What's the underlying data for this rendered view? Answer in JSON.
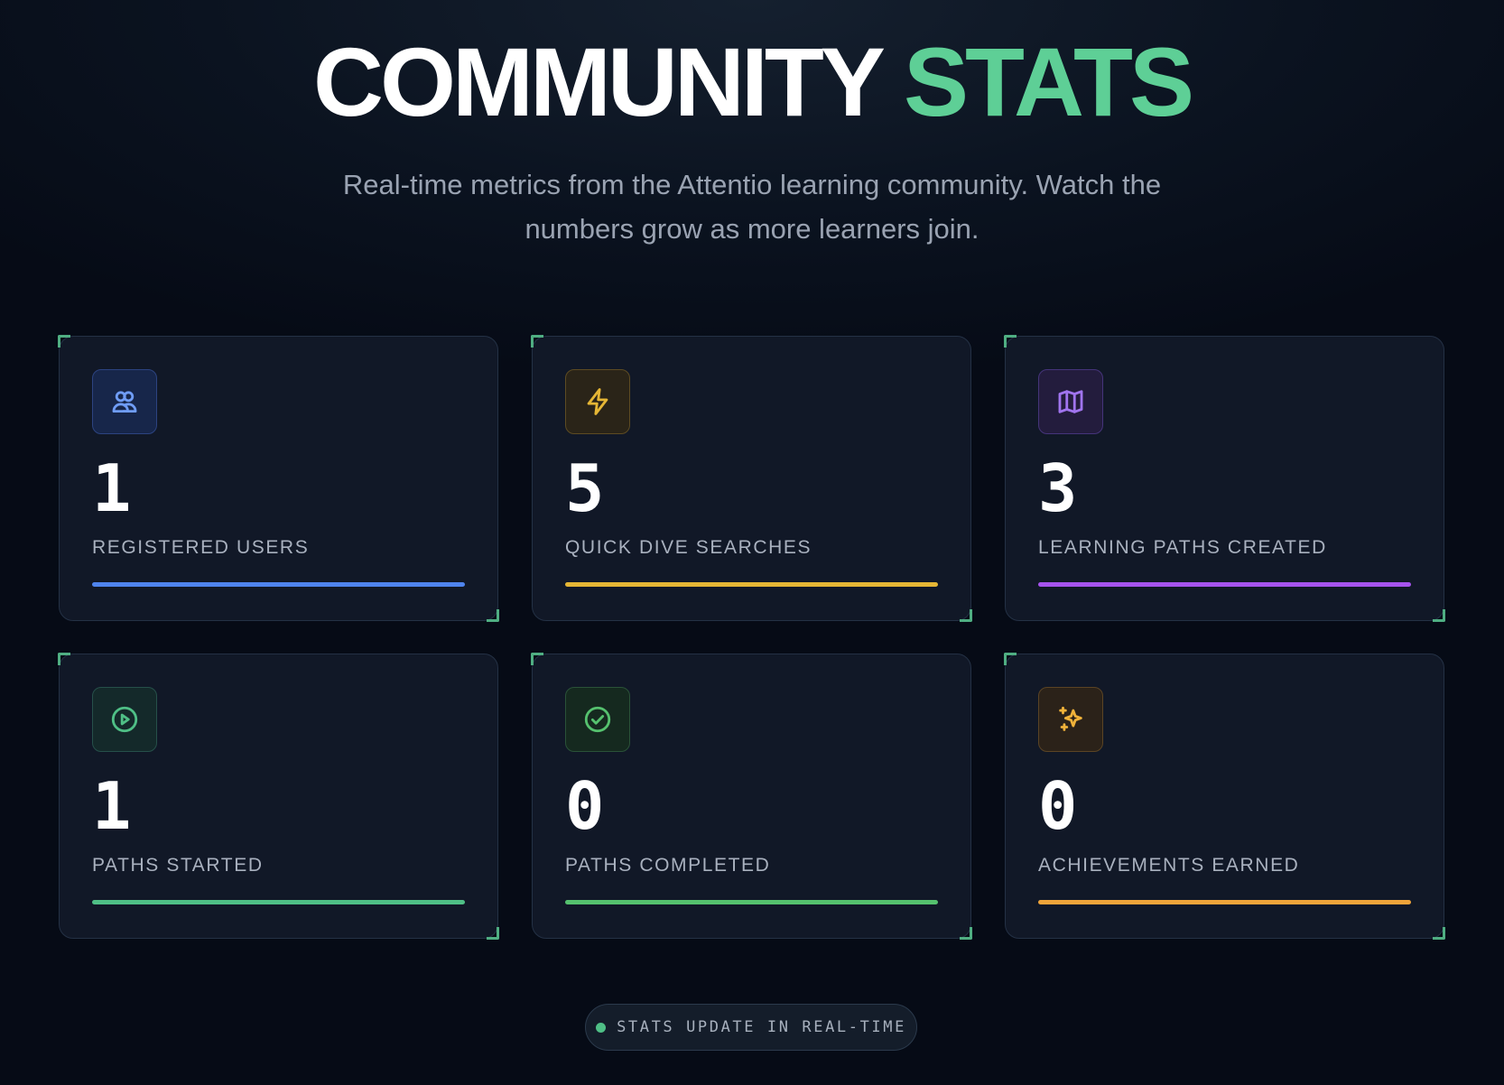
{
  "header": {
    "title_part1": "COMMUNITY",
    "title_part2": "STATS",
    "subtitle": "Real-time metrics from the Attentio learning community. Watch the numbers grow as more learners join."
  },
  "stats": [
    {
      "value": "1",
      "label": "REGISTERED USERS",
      "icon": "users-icon",
      "accent": "#4f84ee"
    },
    {
      "value": "5",
      "label": "QUICK DIVE SEARCHES",
      "icon": "lightning-icon",
      "accent": "#e5b635"
    },
    {
      "value": "3",
      "label": "LEARNING PATHS CREATED",
      "icon": "map-icon",
      "accent": "#a653ee"
    },
    {
      "value": "1",
      "label": "PATHS STARTED",
      "icon": "play-circle-icon",
      "accent": "#4fbf86"
    },
    {
      "value": "0",
      "label": "PATHS COMPLETED",
      "icon": "check-circle-icon",
      "accent": "#55c16e"
    },
    {
      "value": "0",
      "label": "ACHIEVEMENTS EARNED",
      "icon": "sparkles-icon",
      "accent": "#f0a43a"
    }
  ],
  "footer": {
    "status_text": "STATS UPDATE IN REAL-TIME",
    "status_color": "#4fbf86"
  },
  "colors": {
    "brand_green": "#5ecf96",
    "background": "#0b1320",
    "card": "#111827"
  }
}
